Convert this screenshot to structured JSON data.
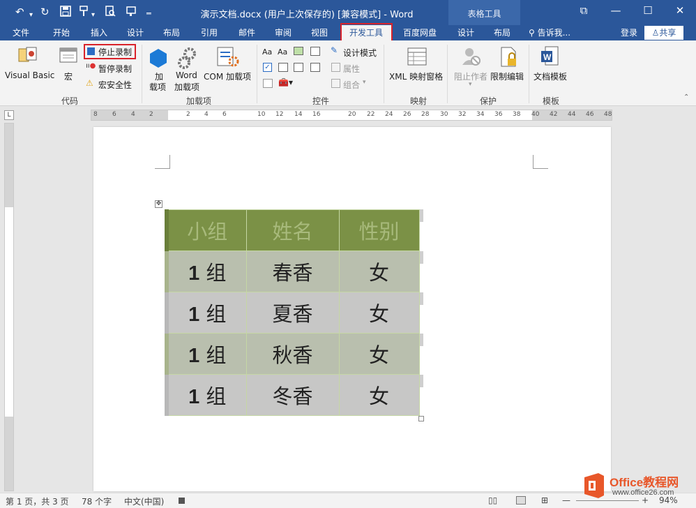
{
  "window": {
    "title": "演示文档.docx (用户上次保存的) [兼容模式] - Word",
    "context_group": "表格工具",
    "signin": "登录",
    "share": "共享",
    "tell_me": "告诉我..."
  },
  "tabs": [
    "文件",
    "开始",
    "插入",
    "设计",
    "布局",
    "引用",
    "邮件",
    "审阅",
    "视图",
    "开发工具",
    "百度网盘",
    "设计",
    "布局"
  ],
  "ribbon": {
    "code": {
      "label": "代码",
      "visual_basic": "Visual Basic",
      "macro": "宏",
      "stop_record": "停止录制",
      "pause_record": "暂停录制",
      "macro_security": "宏安全性"
    },
    "addins": {
      "label": "加载项",
      "addin_line1": "加",
      "addin_line2": "载项",
      "word_line1": "Word",
      "word_line2": "加载项",
      "com": "COM 加载项"
    },
    "controls": {
      "label": "控件",
      "design_mode": "设计模式",
      "properties": "属性",
      "group": "组合"
    },
    "mapping": {
      "label": "映射",
      "xml_pane": "XML 映射窗格"
    },
    "protect": {
      "label": "保护",
      "block_authors": "阻止作者",
      "restrict_editing": "限制编辑"
    },
    "templates": {
      "label": "模板",
      "doc_template": "文档模板"
    }
  },
  "ruler_numbers": [
    "8",
    "6",
    "4",
    "2",
    "2",
    "4",
    "6",
    "10",
    "12",
    "14",
    "16",
    "20",
    "22",
    "24",
    "26",
    "28",
    "30",
    "32",
    "34",
    "36",
    "38",
    "40",
    "42",
    "44",
    "46",
    "48"
  ],
  "table": {
    "headers": [
      "小组",
      "姓名",
      "性别"
    ],
    "rows": [
      {
        "g": "1",
        "gs": "组",
        "name": "春香",
        "sex": "女"
      },
      {
        "g": "1",
        "gs": "组",
        "name": "夏香",
        "sex": "女"
      },
      {
        "g": "1",
        "gs": "组",
        "name": "秋香",
        "sex": "女"
      },
      {
        "g": "1",
        "gs": "组",
        "name": "冬香",
        "sex": "女"
      }
    ]
  },
  "status": {
    "page": "第 1 页，共 3 页",
    "words": "78 个字",
    "lang": "中文(中国)",
    "zoom": "94%"
  },
  "logo": {
    "brand": "Office教程网",
    "url": "www.office26.com"
  }
}
